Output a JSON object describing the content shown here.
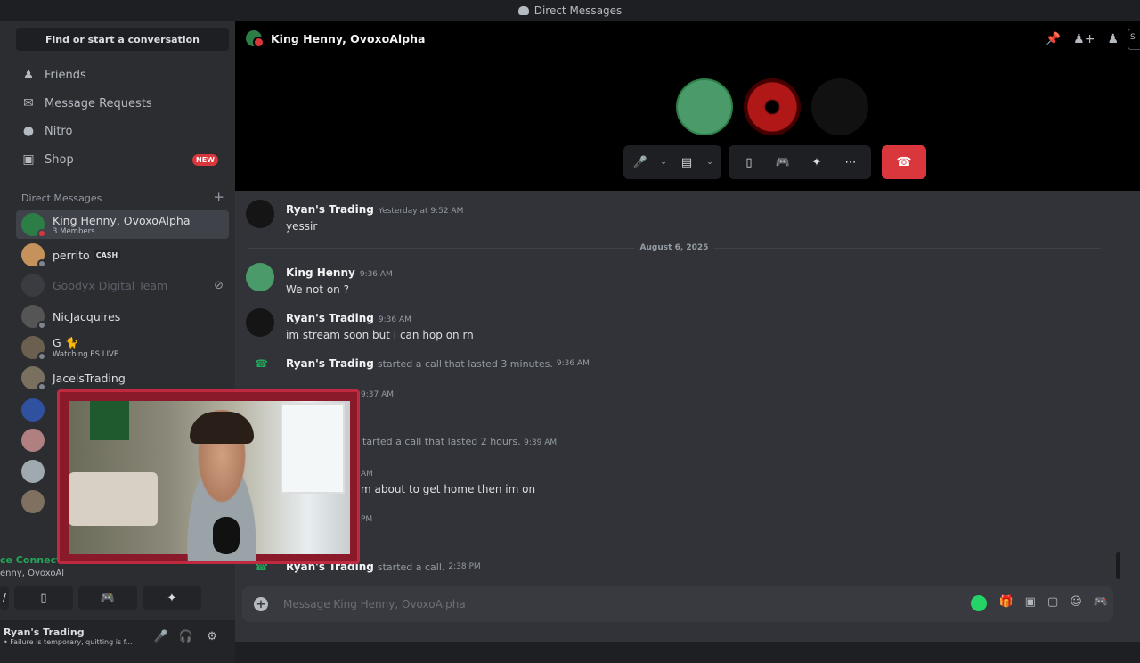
{
  "titlebar": {
    "title": "Direct Messages"
  },
  "sidebar": {
    "search_label": "Find or start a conversation",
    "nav": [
      {
        "label": "Friends",
        "icon": "friends-icon"
      },
      {
        "label": "Message Requests",
        "icon": "mail-icon"
      },
      {
        "label": "Nitro",
        "icon": "nitro-icon"
      },
      {
        "label": "Shop",
        "icon": "shop-icon",
        "badge": "NEW"
      }
    ],
    "dm_header": "Direct Messages",
    "dms": [
      {
        "name": "King Henny, OvoxoAlpha",
        "sub": "3 Members"
      },
      {
        "name": "perrito",
        "tag": "CASH"
      },
      {
        "name": "Goodyx Digital Team"
      },
      {
        "name": "NicJacquires"
      },
      {
        "name": "G 🐈",
        "sub": "Watching ES LIVE"
      },
      {
        "name": "JacelsTrading"
      }
    ]
  },
  "voice": {
    "status": "ce Connect",
    "channel": "enny, OvoxoAl"
  },
  "user": {
    "name": "Ryan's Trading",
    "status": "• Failure is temporary, quitting is f..."
  },
  "channel": {
    "title": "King Henny, OvoxoAlpha"
  },
  "messages": [
    {
      "author": "Ryan's Trading",
      "time": "Yesterday at 9:52 AM",
      "content": "yessir"
    },
    {
      "author": "King Henny",
      "time": "9:36 AM",
      "content": "We not on ?"
    },
    {
      "author": "Ryan's Trading",
      "time": "9:36 AM",
      "content": "im stream soon but i can hop on rn"
    }
  ],
  "date_divider": "August 6, 2025",
  "system": [
    {
      "author": "Ryan's Trading",
      "text": "started a call that lasted 3 minutes.",
      "time": "9:36 AM"
    },
    {
      "author": "Ryan's Trading",
      "text": "started a call.",
      "time": "2:38 PM"
    }
  ],
  "partial": {
    "time1": "9:37 AM",
    "call2": "tarted a call that lasted 2 hours.",
    "call2_time": "9:39 AM",
    "am": "AM",
    "msg": "m about to get home then im on",
    "pm": "PM"
  },
  "composer": {
    "placeholder": "Message King Henny, OvoxoAlpha"
  },
  "colors": {
    "accent": "#da373c",
    "online": "#23a55a",
    "bg": "#313338"
  }
}
